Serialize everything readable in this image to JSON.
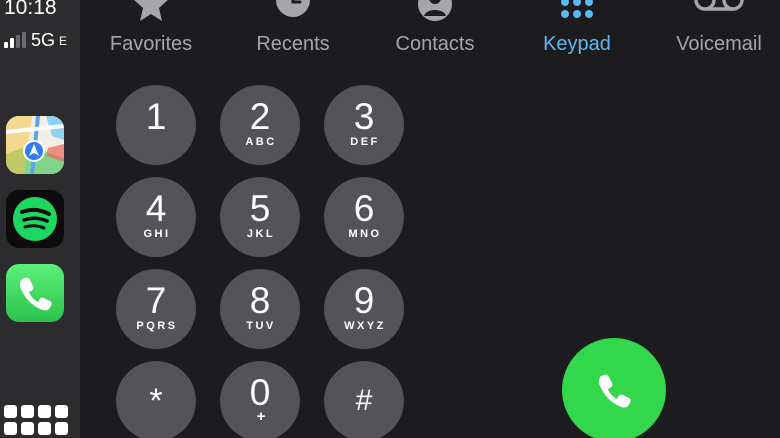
{
  "status": {
    "time": "10:18",
    "network": "5G",
    "network_suffix": "E"
  },
  "sidebar": {
    "apps": [
      {
        "name": "Maps",
        "icon": "maps-icon"
      },
      {
        "name": "Spotify",
        "icon": "spotify-icon"
      },
      {
        "name": "Phone",
        "icon": "phone-icon"
      }
    ],
    "home_icon": "app-grid-icon"
  },
  "tabs": [
    {
      "label": "Favorites",
      "icon": "star-icon",
      "active": false
    },
    {
      "label": "Recents",
      "icon": "clock-icon",
      "active": false
    },
    {
      "label": "Contacts",
      "icon": "person-icon",
      "active": false
    },
    {
      "label": "Keypad",
      "icon": "keypad-icon",
      "active": true
    },
    {
      "label": "Voicemail",
      "icon": "voicemail-icon",
      "active": false
    }
  ],
  "keypad": {
    "keys": [
      {
        "digit": "1",
        "letters": ""
      },
      {
        "digit": "2",
        "letters": "ABC"
      },
      {
        "digit": "3",
        "letters": "DEF"
      },
      {
        "digit": "4",
        "letters": "GHI"
      },
      {
        "digit": "5",
        "letters": "JKL"
      },
      {
        "digit": "6",
        "letters": "MNO"
      },
      {
        "digit": "7",
        "letters": "PQRS"
      },
      {
        "digit": "8",
        "letters": "TUV"
      },
      {
        "digit": "9",
        "letters": "WXYZ"
      },
      {
        "digit": "*",
        "letters": ""
      },
      {
        "digit": "0",
        "letters": "+"
      },
      {
        "digit": "#",
        "letters": ""
      }
    ]
  },
  "call_button": {
    "icon": "phone-icon"
  },
  "colors": {
    "accent": "#5ab9f1",
    "call_green": "#32d74b",
    "key_bg": "#545458",
    "sidebar_bg": "#2c2c2e",
    "background": "#1c1c1e",
    "inactive_tab": "#a6a6aa"
  }
}
